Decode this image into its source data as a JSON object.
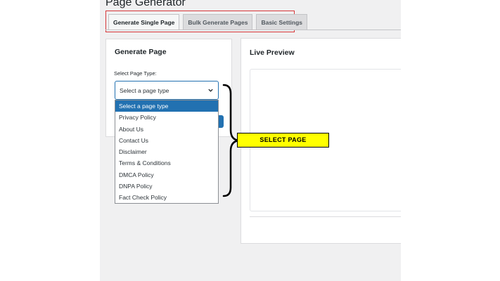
{
  "header": {
    "title": "Page Generator"
  },
  "tabs": [
    {
      "label": "Generate Single Page",
      "active": true
    },
    {
      "label": "Bulk Generate Pages",
      "active": false
    },
    {
      "label": "Basic Settings",
      "active": false
    }
  ],
  "generate_panel": {
    "title": "Generate Page",
    "field_label": "Select Page Type:",
    "select_value": "Select a page type",
    "options": [
      "Select a page type",
      "Privacy Policy",
      "About Us",
      "Contact Us",
      "Disclaimer",
      "Terms & Conditions",
      "DMCA Policy",
      "DNPA Policy",
      "Fact Check Policy"
    ]
  },
  "preview_panel": {
    "title": "Live Preview"
  },
  "annotation": {
    "label": "SELECT PAGE"
  },
  "colors": {
    "accent": "#2271b1",
    "highlight_outline": "#d63638",
    "callout_fill": "#ffff00"
  }
}
